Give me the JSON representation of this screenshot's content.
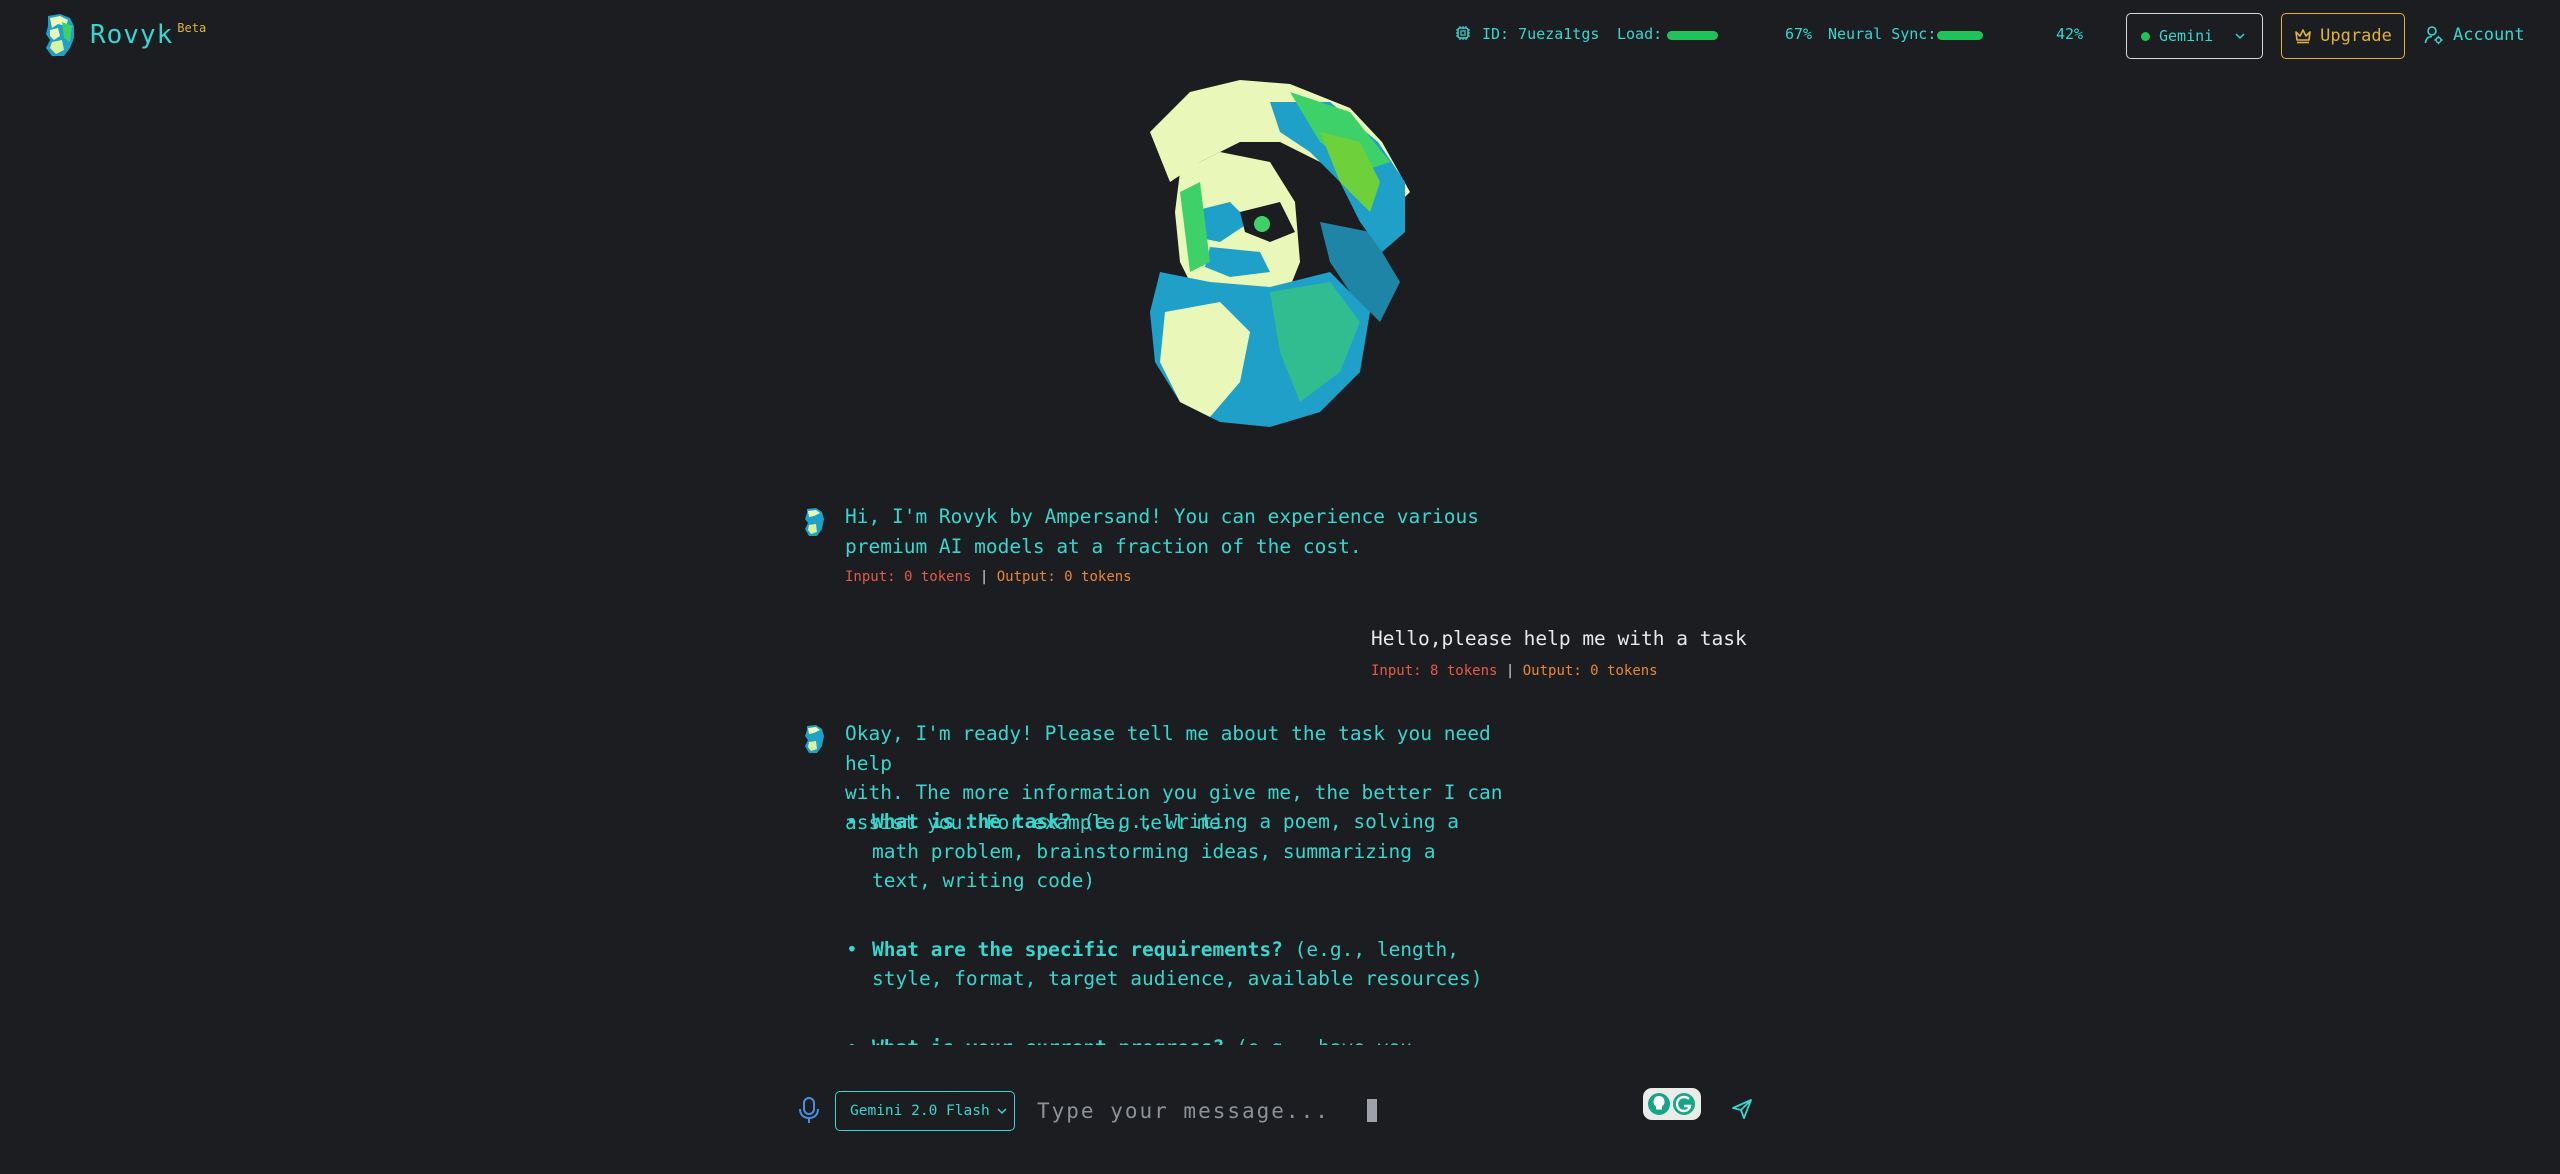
{
  "header": {
    "brand_name": "Rovyk",
    "brand_badge": "Beta",
    "id_label": "ID: 7ueza1tgs",
    "load_label": "Load:",
    "load_value": "67%",
    "load_fraction": 0.67,
    "sync_label": "Neural Sync:",
    "sync_value": "42%",
    "sync_fraction": 0.42,
    "model_select": "Gemini",
    "upgrade_label": "Upgrade",
    "account_label": "Account"
  },
  "chat": {
    "messages": [
      {
        "role": "assistant",
        "text_lines": [
          "Hi, I'm Rovyk by Ampersand! You can experience various",
          "premium AI models at a fraction of the cost."
        ],
        "input_tokens": "Input: 0 tokens",
        "separator": "|",
        "output_tokens": "Output: 0 tokens"
      },
      {
        "role": "user",
        "text": "Hello,please help me with a task",
        "input_tokens": "Input: 8 tokens",
        "separator": "|",
        "output_tokens": "Output: 0 tokens"
      },
      {
        "role": "assistant",
        "text_lines": [
          "Okay, I'm ready! Please tell me about the task you need help",
          "with. The more information you give me, the better I can",
          "assist you. For example, tell me:"
        ],
        "bullets": [
          {
            "bold": "What is the task?",
            "rest": " (e.g., writing a poem, solving a math problem, brainstorming ideas, summarizing a text, writing code)"
          },
          {
            "bold": "What are the specific requirements?",
            "rest": " (e.g., length, style, format, target audience, available resources)"
          },
          {
            "bold": "What is your current progress?",
            "rest": " (e.g., have you started"
          }
        ]
      }
    ]
  },
  "composer": {
    "model_chip": "Gemini 2.0 Flash",
    "placeholder": "Type your message..."
  },
  "colors": {
    "background": "#1b1d21",
    "accent": "#38d6cf",
    "upgrade": "#e0b23c",
    "bar": "#1fc25b",
    "input_tokens": "#e55a4a",
    "output_tokens": "#e8873a"
  },
  "icons": [
    "rovyk-logo-icon",
    "cpu-icon",
    "chevron-down-icon",
    "crown-icon",
    "user-settings-icon",
    "microphone-icon",
    "grammarly-icon",
    "send-icon"
  ]
}
